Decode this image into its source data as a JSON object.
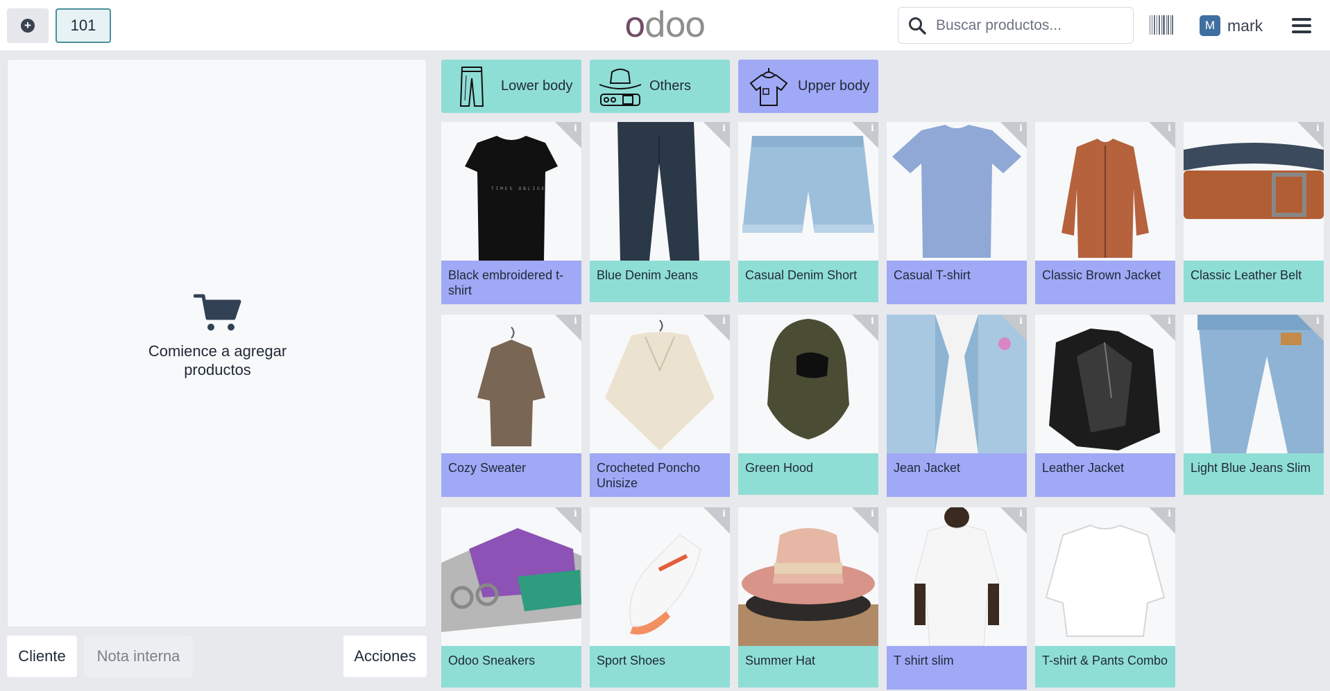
{
  "header": {
    "table_number": "101",
    "logo_first": "o",
    "logo_rest": "doo",
    "search_placeholder": "Buscar productos...",
    "user_initial": "M",
    "user_name": "mark"
  },
  "order": {
    "empty_message": "Comience a agregar productos",
    "cliente_label": "Cliente",
    "nota_label": "Nota interna",
    "acciones_label": "Acciones"
  },
  "categories": [
    {
      "label": "Lower body",
      "icon": "pants-icon",
      "color": "#8fded6"
    },
    {
      "label": "Others",
      "icon": "hat-belt-icon",
      "color": "#8fded6"
    },
    {
      "label": "Upper body",
      "icon": "tshirt-icon",
      "color": "#a0a9f5"
    }
  ],
  "products": [
    {
      "name": "Black embroidered t-shirt",
      "category": "Upper body"
    },
    {
      "name": "Blue Denim Jeans",
      "category": "Lower body"
    },
    {
      "name": "Casual Denim Short",
      "category": "Lower body"
    },
    {
      "name": "Casual T-shirt",
      "category": "Upper body"
    },
    {
      "name": "Classic Brown Jacket",
      "category": "Upper body"
    },
    {
      "name": "Classic Leather Belt",
      "category": "Others"
    },
    {
      "name": "Cozy Sweater",
      "category": "Upper body"
    },
    {
      "name": "Crocheted Poncho Unisize",
      "category": "Upper body"
    },
    {
      "name": "Green Hood",
      "category": "Others"
    },
    {
      "name": "Jean Jacket",
      "category": "Upper body"
    },
    {
      "name": "Leather Jacket",
      "category": "Upper body"
    },
    {
      "name": "Light Blue Jeans Slim",
      "category": "Lower body"
    },
    {
      "name": "Odoo Sneakers",
      "category": "Others"
    },
    {
      "name": "Sport Shoes",
      "category": "Others"
    },
    {
      "name": "Summer Hat",
      "category": "Others"
    },
    {
      "name": "T shirt slim",
      "category": "Upper body"
    },
    {
      "name": "T-shirt & Pants Combo",
      "category": "Others"
    }
  ],
  "info_glyph": "i",
  "colors": {
    "teal": "#8fded6",
    "blue": "#a0a9f5",
    "brand": "#714b67"
  }
}
